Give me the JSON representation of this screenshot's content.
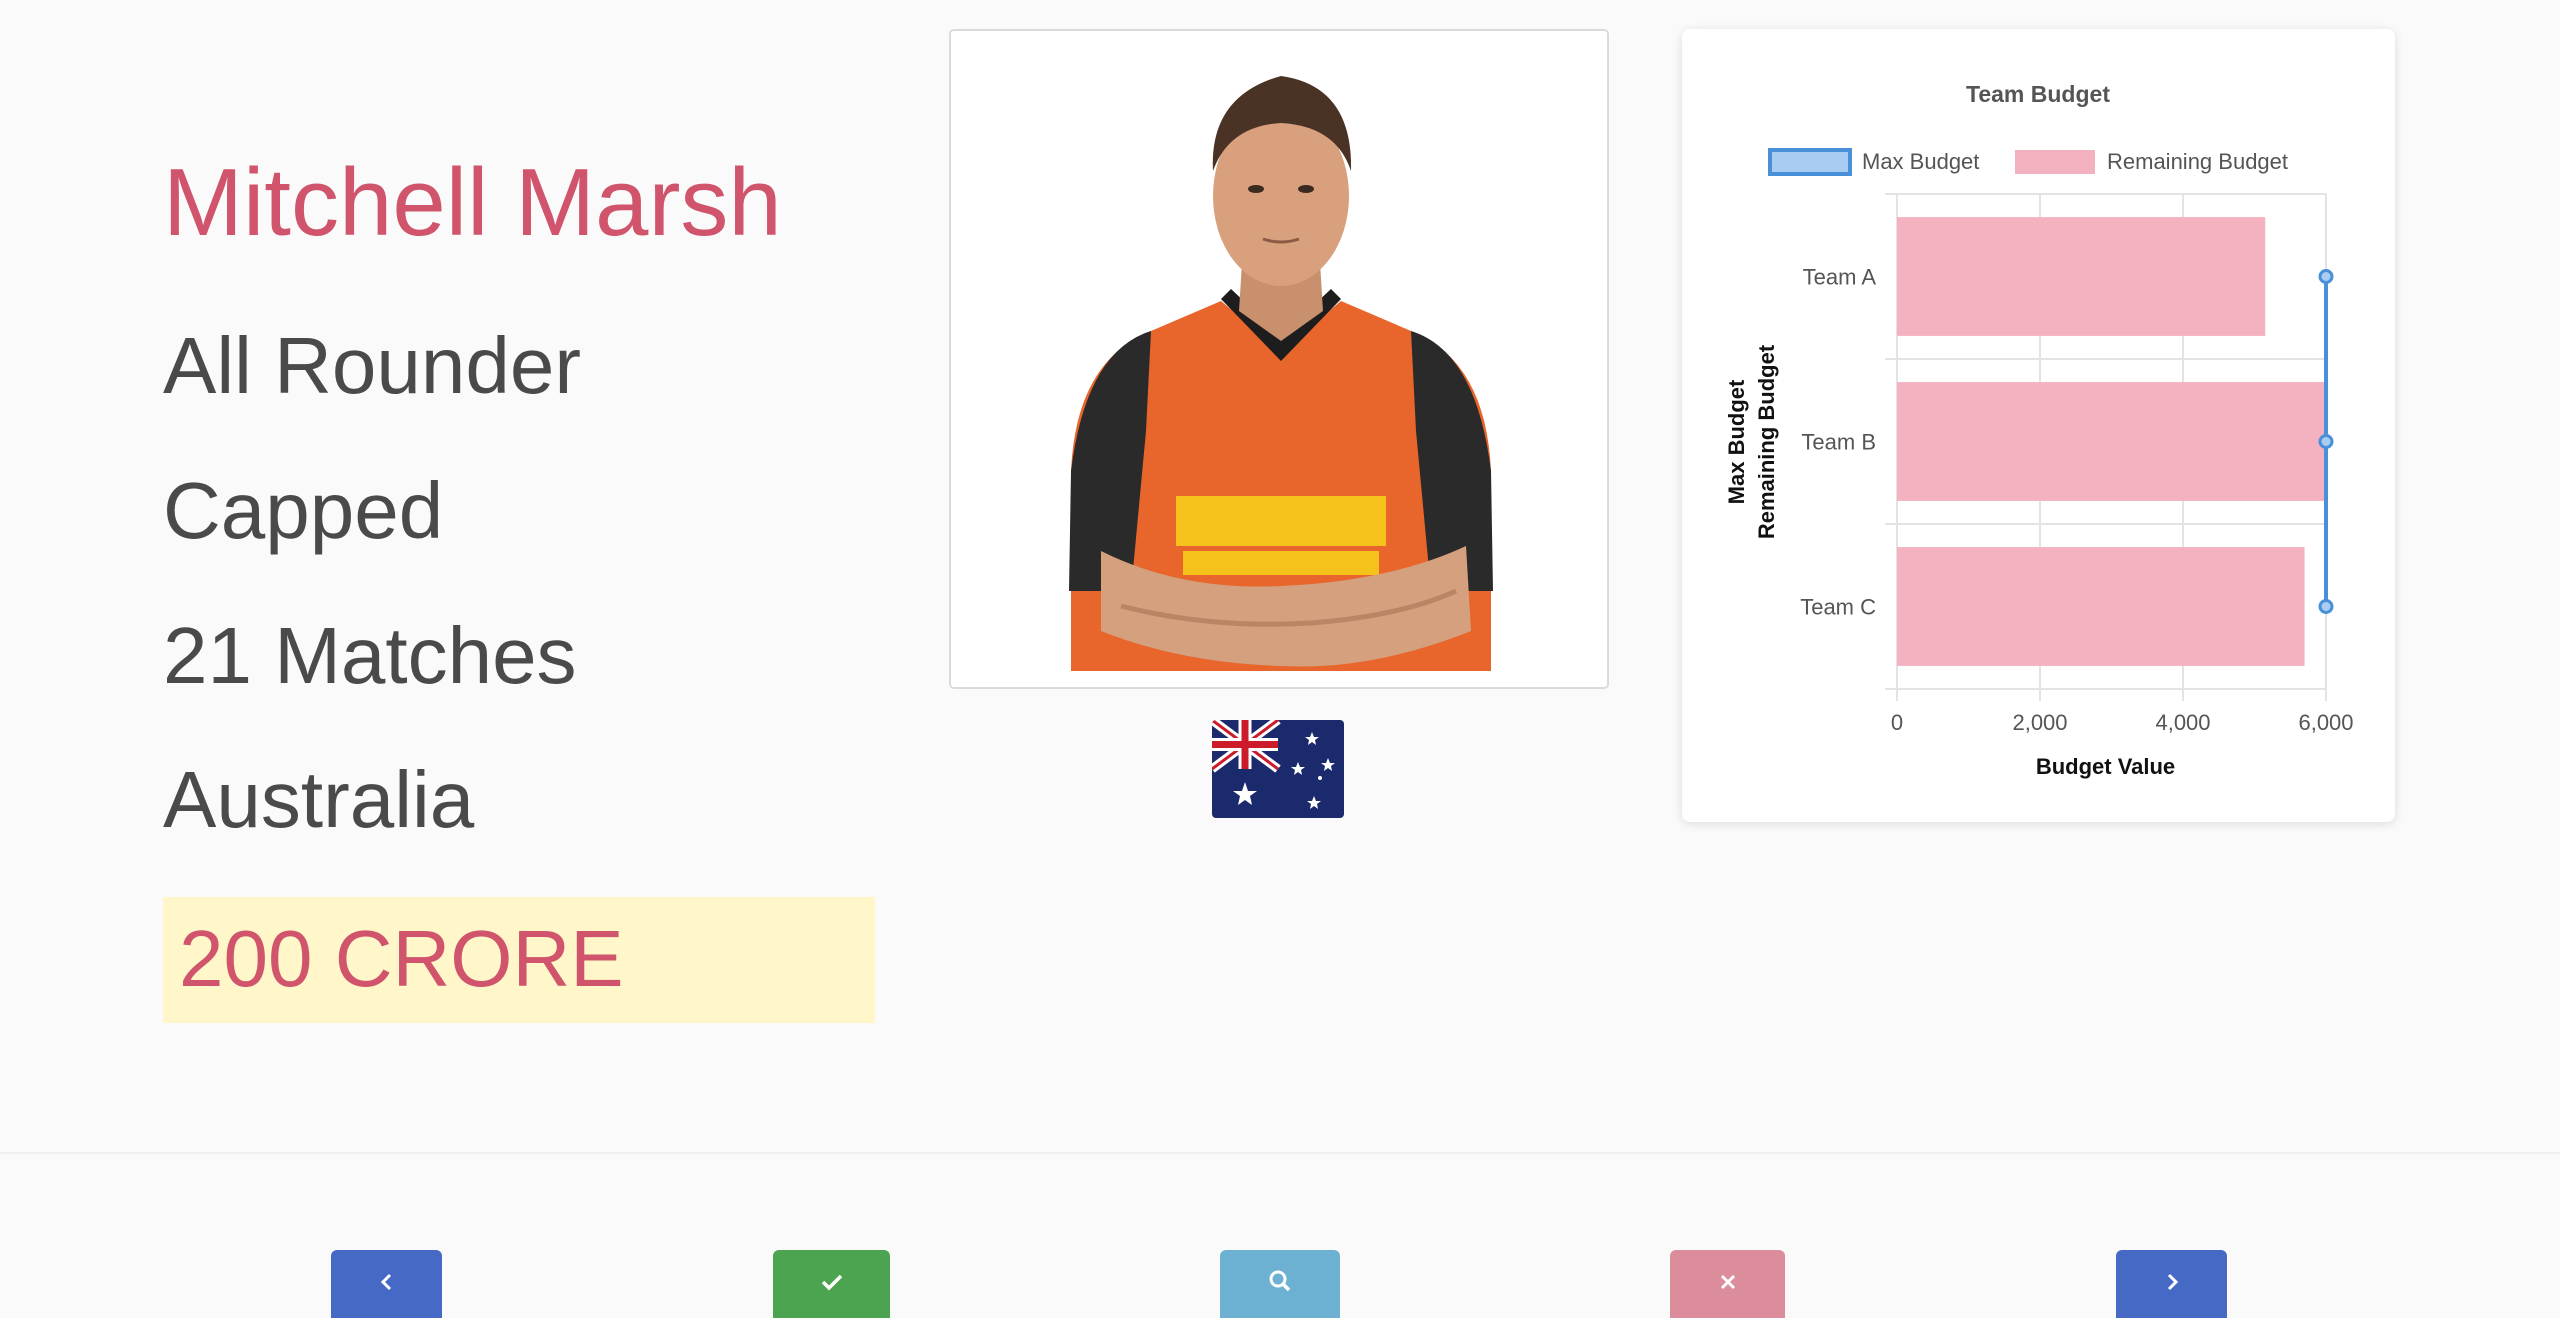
{
  "player": {
    "name": "Mitchell Marsh",
    "role": "All Rounder",
    "status": "Capped",
    "matches": "21 Matches",
    "country": "Australia",
    "price": "200 CRORE"
  },
  "colors": {
    "accent": "#d0546b",
    "price_bg": "#fff7c9",
    "max_budget": "#4a90d9",
    "remaining_budget": "#f4b1bf"
  },
  "icons": {
    "prev": "chevron-left-icon",
    "sold": "check-icon",
    "search": "search-icon",
    "unsold": "close-icon",
    "next": "chevron-right-icon"
  },
  "chart_data": {
    "type": "bar",
    "orientation": "horizontal",
    "title": "Team Budget",
    "categories": [
      "Team A",
      "Team B",
      "Team C"
    ],
    "series": [
      {
        "name": "Max Budget",
        "type": "line",
        "values": [
          6000,
          6000,
          6000
        ]
      },
      {
        "name": "Remaining Budget",
        "type": "bar",
        "values": [
          5150,
          6000,
          5700
        ]
      }
    ],
    "xlabel": "Budget Value",
    "ylabel": [
      "Max Budget",
      "Remaining Budget"
    ],
    "xlim": [
      0,
      6000
    ],
    "xticks": [
      "0",
      "2,000",
      "4,000",
      "6,000"
    ],
    "legend": "top",
    "grid": true
  }
}
